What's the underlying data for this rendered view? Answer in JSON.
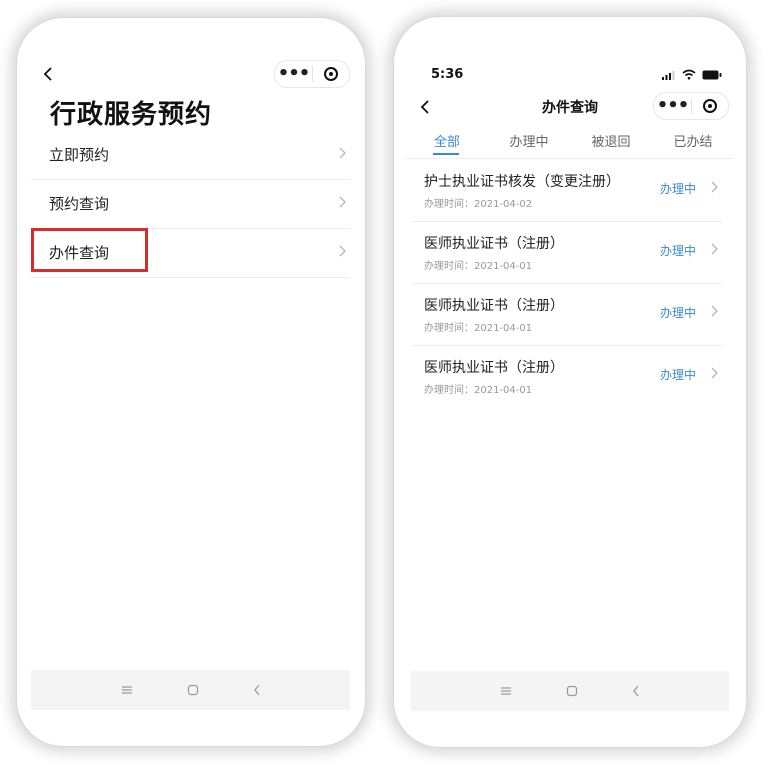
{
  "left": {
    "page_title": "行政服务预约",
    "menu_items": [
      {
        "label": "立即预约"
      },
      {
        "label": "预约查询"
      },
      {
        "label": "办件查询"
      }
    ]
  },
  "right": {
    "status_time": "5:36",
    "page_title": "办件查询",
    "tabs": [
      {
        "label": "全部",
        "active": true
      },
      {
        "label": "办理中"
      },
      {
        "label": "被退回"
      },
      {
        "label": "已办结"
      }
    ],
    "records": [
      {
        "name": "护士执业证书核发（变更注册）",
        "date": "办理时间：2021-04-02",
        "status": "办理中"
      },
      {
        "name": "医师执业证书（注册）",
        "date": "办理时间：2021-04-01",
        "status": "办理中"
      },
      {
        "name": "医师执业证书（注册）",
        "date": "办理时间：2021-04-01",
        "status": "办理中"
      },
      {
        "name": "医师执业证书（注册）",
        "date": "办理时间：2021-04-01",
        "status": "办理中"
      }
    ]
  },
  "capsule": {
    "more_label": "•••"
  },
  "nav_icons": [
    "menu-icon",
    "home-icon",
    "back-icon"
  ],
  "colors": {
    "accent": "#3a8bd6",
    "highlight": "#d62c2c"
  }
}
